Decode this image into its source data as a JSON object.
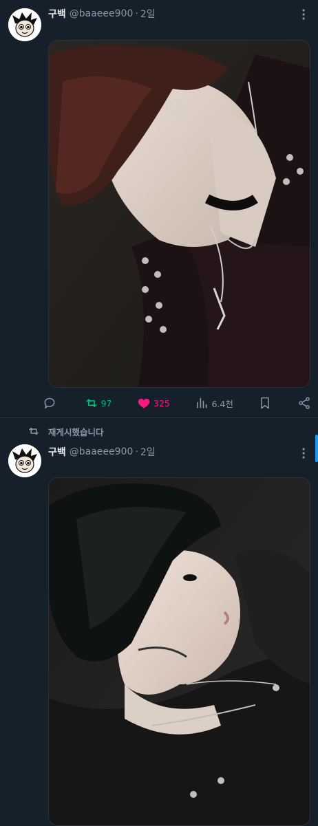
{
  "colors": {
    "background": "#15202b",
    "retweet_green": "#00ba7c",
    "like_pink": "#f91880",
    "muted": "#8b98a5",
    "accent": "#1d9bf0"
  },
  "tweets": [
    {
      "author_name": "구백",
      "handle": "@baaeee900",
      "separator": "·",
      "time": "2일",
      "more_icon": "more-vertical-icon",
      "media_alt": "illustration-dark-haired-figure-looking-down",
      "actions": {
        "reply": "",
        "retweets": "97",
        "likes": "325",
        "views": "6.4천"
      }
    },
    {
      "repost_label": "재게시했습니다",
      "author_name": "구백",
      "handle": "@baaeee900",
      "separator": "·",
      "time": "2일",
      "more_icon": "more-vertical-icon",
      "media_alt": "illustration-black-haired-figure-looking-up"
    }
  ]
}
